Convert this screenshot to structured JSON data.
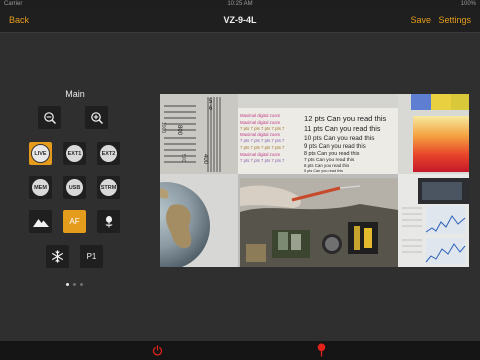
{
  "status_bar": {
    "carrier": "Carrier",
    "time": "10:25 AM",
    "battery": "100%"
  },
  "nav": {
    "back": "Back",
    "title": "VZ-9-4L",
    "save": "Save",
    "settings": "Settings"
  },
  "panel": {
    "title": "Main",
    "buttons": {
      "zoom_out_icon": "magnifier-minus",
      "zoom_in_icon": "magnifier-plus",
      "live": "LIVE",
      "ext1": "EXT1",
      "ext2": "EXT2",
      "mem": "MEM",
      "usb": "USB",
      "strm": "STRM",
      "landscape_icon": "mountain-landscape",
      "af": "AF",
      "macro_icon": "flower-macro",
      "snow_icon": "snowflake",
      "p1": "P1"
    },
    "active": [
      "LIVE",
      "AF"
    ],
    "page": {
      "current": 1,
      "total": 3
    }
  },
  "preview": {
    "test_chart": {
      "zoom_lines": [
        "Maximal digital zoom",
        "Maximal digital zoom",
        "7 pts 7 pts 7 pts 7 pts 7",
        "Maximal digital zoom",
        "7 pts 7 pts 7 pts 7 pts 7",
        "7 pts 7 pts 7 pts 7 pts 7",
        "Maximal digital zoom",
        "7 pts 7 pts 7 pts 7 pts 7"
      ],
      "read_lines": [
        "12 pts Can you read this",
        "11 pts Can you read this",
        "10 pts Can you read this",
        "9 pts Can you read this",
        "8 pts Can you read this",
        "7 pts Can you read this",
        "6 pts Can you read this",
        "5 pts Can you read this"
      ],
      "ruler_numbers": [
        "800",
        "400",
        "1000",
        "500",
        "5",
        "6"
      ]
    }
  },
  "bottom_bar": {
    "power_icon": "power-icon",
    "pin_icon": "map-pin-icon"
  },
  "colors": {
    "accent": "#e59b1c",
    "nav_bg": "#1f1f1f",
    "body_bg": "#2f2f2f",
    "alert": "#e3221a"
  }
}
